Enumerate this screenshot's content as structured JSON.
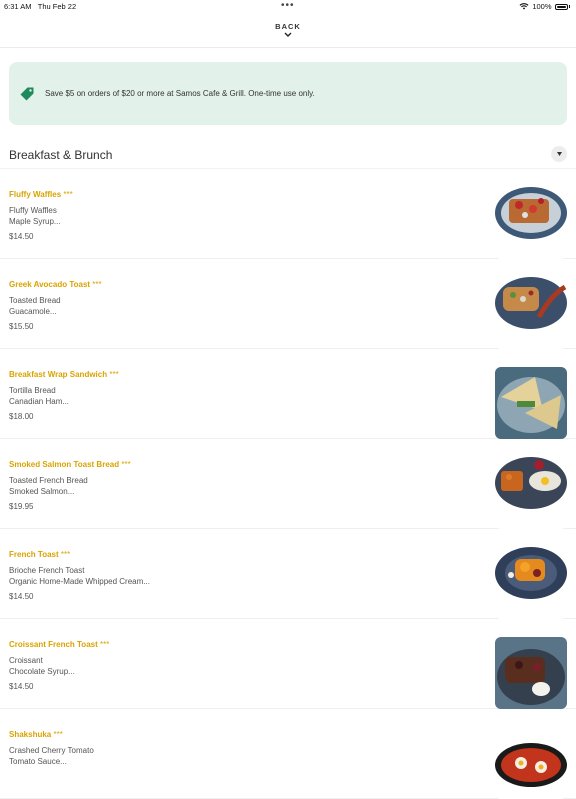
{
  "status": {
    "time": "6:31 AM",
    "date": "Thu Feb 22",
    "battery": "100%"
  },
  "nav": {
    "back_label": "BACK"
  },
  "promo": {
    "text": "Save $5 on orders of $20 or more at Samos Cafe & Grill. One-time use only."
  },
  "section": {
    "title": "Breakfast & Brunch"
  },
  "items": [
    {
      "name": "Fluffy Waffles",
      "stars": "***",
      "desc1": "Fluffy Waffles",
      "desc2": "Maple Syrup...",
      "price": "$14.50"
    },
    {
      "name": "Greek Avocado Toast",
      "stars": "***",
      "desc1": "Toasted Bread",
      "desc2": "Guacamole...",
      "price": "$15.50"
    },
    {
      "name": "Breakfast Wrap Sandwich",
      "stars": "***",
      "desc1": "Tortilla Bread",
      "desc2": "Canadian Ham...",
      "price": "$18.00"
    },
    {
      "name": "Smoked Salmon Toast Bread",
      "stars": "***",
      "desc1": "Toasted French Bread",
      "desc2": "Smoked Salmon...",
      "price": "$19.95"
    },
    {
      "name": "French Toast",
      "stars": "***",
      "desc1": "Brioche French Toast",
      "desc2": "Organic Home-Made Whipped Cream...",
      "price": "$14.50"
    },
    {
      "name": "Croissant French Toast",
      "stars": "***",
      "desc1": "Croissant",
      "desc2": "Chocolate Syrup...",
      "price": "$14.50"
    },
    {
      "name": "Shakshuka",
      "stars": "***",
      "desc1": "Crashed Cherry Tomato",
      "desc2": "Tomato Sauce...",
      "price": ""
    }
  ],
  "colors": {
    "accent": "#d9a300",
    "promo_bg": "#e2f2ea",
    "tag_icon": "#1f8a5b"
  },
  "icons": {
    "wifi": "wifi-icon",
    "battery": "battery-icon",
    "back": "chevron-down-icon",
    "promo": "price-tag-icon",
    "collapse": "triangle-down-icon"
  }
}
